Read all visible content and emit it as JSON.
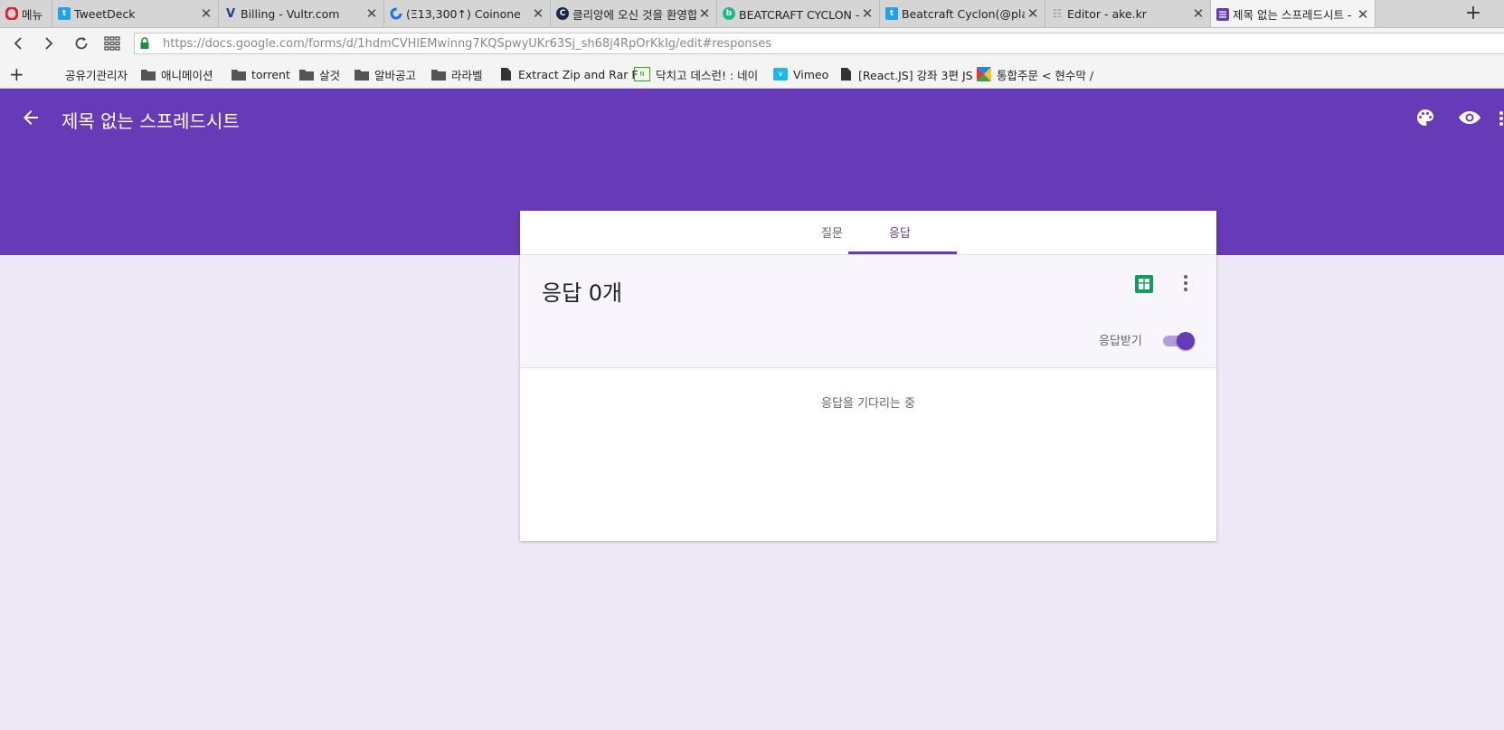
{
  "browser": {
    "tabs": [
      {
        "title": "메뉴",
        "icon": "opera-icon",
        "close": false
      },
      {
        "title": "TweetDeck",
        "icon": "twitter-icon",
        "close": true
      },
      {
        "title": "Billing - Vultr.com",
        "icon": "vultr-icon",
        "close": true
      },
      {
        "title": "(Ξ13,300↑) Coinone",
        "icon": "coinone-icon",
        "close": true
      },
      {
        "title": "클리앙에 오신 것을 환영합",
        "icon": "clien-icon",
        "close": true
      },
      {
        "title": "BEATCRAFT CYCLON - 나",
        "icon": "beatcraft-icon",
        "close": true
      },
      {
        "title": "Beatcraft Cyclon(@playcyc",
        "icon": "twitter-icon",
        "close": true
      },
      {
        "title": "Editor - ake.kr",
        "icon": "editor-icon",
        "close": true
      },
      {
        "title": "제목 없는 스프레드시트 - ",
        "icon": "forms-icon",
        "close": true,
        "active": true
      }
    ],
    "url": "https://docs.google.com/forms/d/1hdmCVHlEMwinng7KQSpwyUKr63Sj_sh68j4RpOrKkIg/edit#responses",
    "bookmarks": [
      {
        "label": "공유기관리자",
        "icon": "none"
      },
      {
        "label": "애니메이션",
        "icon": "folder-icon"
      },
      {
        "label": "torrent",
        "icon": "folder-icon"
      },
      {
        "label": "살것",
        "icon": "folder-icon"
      },
      {
        "label": "알바공고",
        "icon": "folder-icon"
      },
      {
        "label": "라라벨",
        "icon": "folder-icon"
      },
      {
        "label": "Extract Zip and Rar F",
        "icon": "page-icon"
      },
      {
        "label": "닥치고 데스런! : 네이",
        "icon": "naver-icon"
      },
      {
        "label": "Vimeo",
        "icon": "vimeo-icon"
      },
      {
        "label": "[React.JS] 강좌 3편 JS",
        "icon": "page-icon"
      },
      {
        "label": "통합주문 < 현수막 /",
        "icon": "color-icon"
      }
    ]
  },
  "header": {
    "title": "제목 없는 스프레드시트"
  },
  "card": {
    "tabs": [
      "질문",
      "응답"
    ],
    "response_count": "응답 0개",
    "accept_label": "응답받기",
    "accepting": true,
    "waiting_text": "응답을 기다리는 중"
  },
  "colors": {
    "accent": "#673ab7",
    "background": "#ede7f6",
    "sheets_green": "#0f9d58"
  }
}
